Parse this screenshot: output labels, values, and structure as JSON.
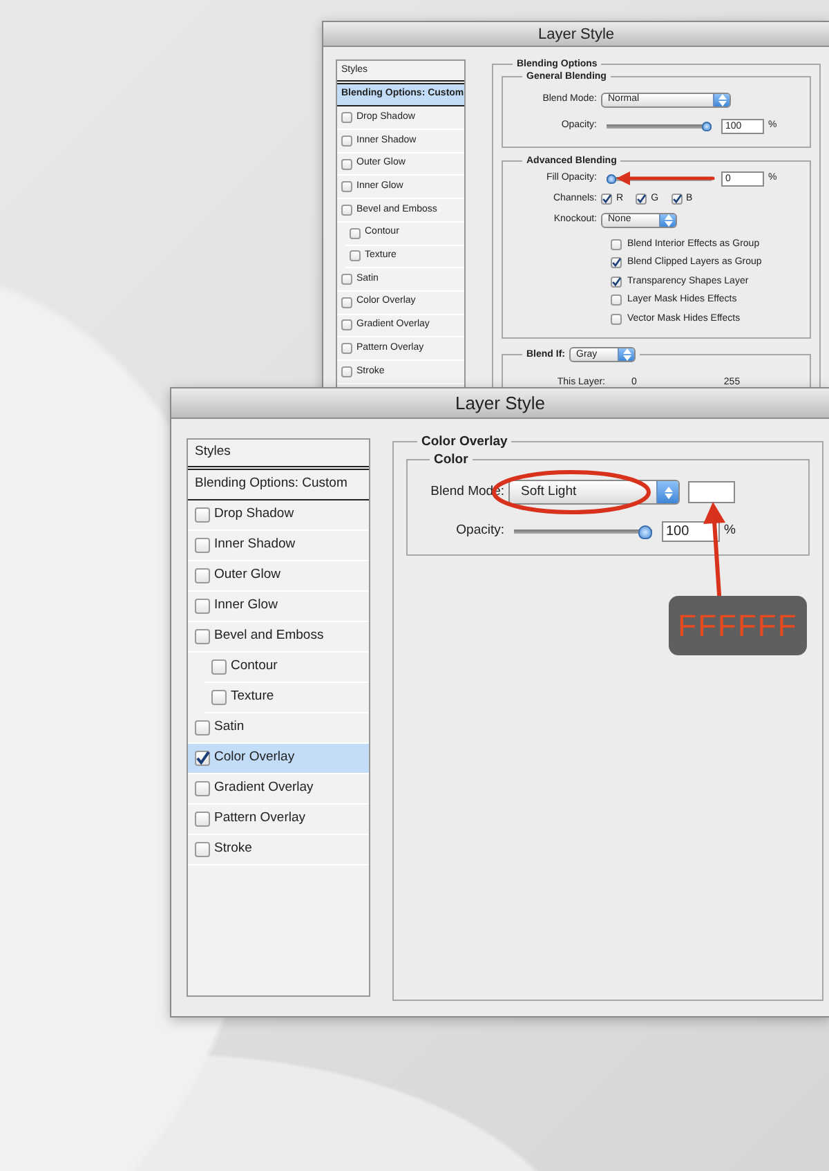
{
  "back_window": {
    "title": "Layer Style",
    "styles": [
      {
        "label": "Styles",
        "kind": "header",
        "selected": false
      },
      {
        "label": "Blending Options: Custom",
        "kind": "option",
        "selected": true
      },
      {
        "label": "Drop Shadow",
        "kind": "effect",
        "checked": false,
        "selected": false
      },
      {
        "label": "Inner Shadow",
        "kind": "effect",
        "checked": false,
        "selected": false
      },
      {
        "label": "Outer Glow",
        "kind": "effect",
        "checked": false,
        "selected": false
      },
      {
        "label": "Inner Glow",
        "kind": "effect",
        "checked": false,
        "selected": false
      },
      {
        "label": "Bevel and Emboss",
        "kind": "effect",
        "checked": false,
        "selected": false,
        "children": [
          {
            "label": "Contour",
            "kind": "effect",
            "checked": false,
            "selected": false
          },
          {
            "label": "Texture",
            "kind": "effect",
            "checked": false,
            "selected": false
          }
        ]
      },
      {
        "label": "Satin",
        "kind": "effect",
        "checked": false,
        "selected": false
      },
      {
        "label": "Color Overlay",
        "kind": "effect",
        "checked": false,
        "selected": false
      },
      {
        "label": "Gradient Overlay",
        "kind": "effect",
        "checked": false,
        "selected": false
      },
      {
        "label": "Pattern Overlay",
        "kind": "effect",
        "checked": false,
        "selected": false
      },
      {
        "label": "Stroke",
        "kind": "effect",
        "checked": false,
        "selected": false
      }
    ],
    "blending_options": {
      "title": "Blending Options",
      "general_blending": {
        "title": "General Blending",
        "blend_mode": {
          "label": "Blend Mode:",
          "value": "Normal"
        },
        "opacity": {
          "label": "Opacity:",
          "level": 1,
          "value": "100",
          "unit": "%"
        }
      },
      "advanced_blending": {
        "title": "Advanced Blending",
        "fill_opacity": {
          "label": "Fill Opacity:",
          "level": 0,
          "value": "0",
          "unit": "%"
        },
        "channels": {
          "label": "Channels:",
          "items": [
            {
              "label": "R",
              "checked": true
            },
            {
              "label": "G",
              "checked": true
            },
            {
              "label": "B",
              "checked": true
            }
          ]
        },
        "knockout": {
          "label": "Knockout:",
          "value": "None"
        },
        "options": [
          {
            "label": "Blend Interior Effects as Group",
            "checked": false
          },
          {
            "label": "Blend Clipped Layers as Group",
            "checked": true
          },
          {
            "label": "Transparency Shapes Layer",
            "checked": true
          },
          {
            "label": "Layer Mask Hides Effects",
            "checked": false
          },
          {
            "label": "Vector Mask Hides Effects",
            "checked": false
          }
        ]
      },
      "blend_if": {
        "label": "Blend If:",
        "value": "Gray",
        "this_layer": {
          "label": "This Layer:",
          "values": [
            "0",
            "255"
          ]
        }
      }
    }
  },
  "front_window": {
    "title": "Layer Style",
    "styles": [
      {
        "label": "Styles",
        "kind": "header",
        "selected": false
      },
      {
        "label": "Blending Options: Custom",
        "kind": "option",
        "selected": false
      },
      {
        "label": "Drop Shadow",
        "kind": "effect",
        "checked": false,
        "selected": false
      },
      {
        "label": "Inner Shadow",
        "kind": "effect",
        "checked": false,
        "selected": false
      },
      {
        "label": "Outer Glow",
        "kind": "effect",
        "checked": false,
        "selected": false
      },
      {
        "label": "Inner Glow",
        "kind": "effect",
        "checked": false,
        "selected": false
      },
      {
        "label": "Bevel and Emboss",
        "kind": "effect",
        "checked": false,
        "selected": false,
        "children": [
          {
            "label": "Contour",
            "kind": "effect",
            "checked": false,
            "selected": false
          },
          {
            "label": "Texture",
            "kind": "effect",
            "checked": false,
            "selected": false
          }
        ]
      },
      {
        "label": "Satin",
        "kind": "effect",
        "checked": false,
        "selected": false
      },
      {
        "label": "Color Overlay",
        "kind": "effect",
        "checked": true,
        "selected": true
      },
      {
        "label": "Gradient Overlay",
        "kind": "effect",
        "checked": false,
        "selected": false
      },
      {
        "label": "Pattern Overlay",
        "kind": "effect",
        "checked": false,
        "selected": false
      },
      {
        "label": "Stroke",
        "kind": "effect",
        "checked": false,
        "selected": false
      }
    ],
    "color_overlay": {
      "title": "Color Overlay",
      "color": {
        "title": "Color",
        "blend_mode": {
          "label": "Blend Mode:",
          "value": "Soft Light"
        },
        "opacity": {
          "label": "Opacity:",
          "level": 1,
          "value": "100",
          "unit": "%"
        }
      }
    },
    "callout": {
      "text": "FFFFFF"
    }
  }
}
